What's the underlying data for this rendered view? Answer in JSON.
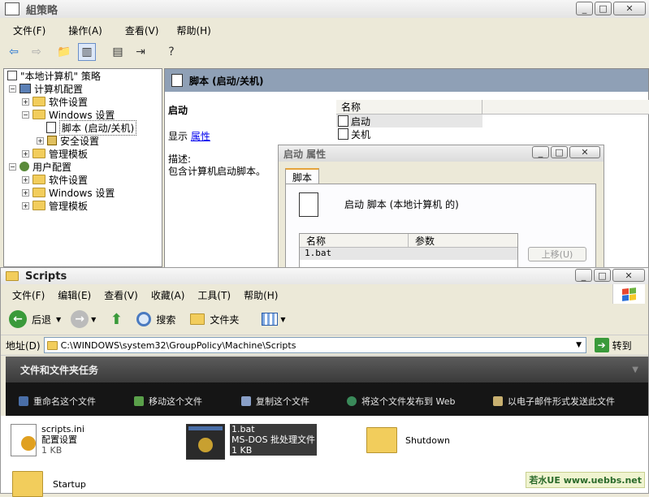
{
  "gp": {
    "title": "組策略",
    "menu": [
      "文件(F)",
      "操作(A)",
      "查看(V)",
      "帮助(H)"
    ],
    "tree": {
      "root": "\"本地计算机\" 策略",
      "computer": "计算机配置",
      "software1": "软件设置",
      "windows1": "Windows 设置",
      "scripts": "脚本 (启动/关机)",
      "security": "安全设置",
      "admin1": "管理模板",
      "user": "用户配置",
      "software2": "软件设置",
      "windows2": "Windows 设置",
      "admin2": "管理模板"
    },
    "header": "脚本 (启动/关机)",
    "detail": {
      "heading": "启动",
      "show": "显示",
      "props": "属性",
      "desc_label": "描述:",
      "desc": "包含计算机启动脚本。"
    },
    "list": {
      "col": "名称",
      "items": [
        "启动",
        "关机"
      ]
    }
  },
  "dlg": {
    "title": "启动 属性",
    "tab": "脚本",
    "heading": "启动 脚本 (本地计算机 的)",
    "cols": [
      "名称",
      "参数"
    ],
    "row": "1.bat",
    "up": "上移(U)"
  },
  "ex": {
    "title": "Scripts",
    "menu": [
      "文件(F)",
      "编辑(E)",
      "查看(V)",
      "收藏(A)",
      "工具(T)",
      "帮助(H)"
    ],
    "back": "后退",
    "search": "搜索",
    "folders": "文件夹",
    "addr_label": "地址(D)",
    "addr": "C:\\WINDOWS\\system32\\GroupPolicy\\Machine\\Scripts",
    "go": "转到",
    "tasks_title": "文件和文件夹任务",
    "tasks": [
      "重命名这个文件",
      "移动这个文件",
      "复制这个文件",
      "将这个文件发布到 Web",
      "以电子邮件形式发送此文件"
    ],
    "files": [
      {
        "name": "scripts.ini",
        "type": "配置设置",
        "size": "1 KB"
      },
      {
        "name": "1.bat",
        "type": "MS-DOS 批处理文件",
        "size": "1 KB"
      },
      {
        "name": "Shutdown"
      },
      {
        "name": "Startup"
      }
    ]
  },
  "watermark": "若水UE www.uebbs.net"
}
